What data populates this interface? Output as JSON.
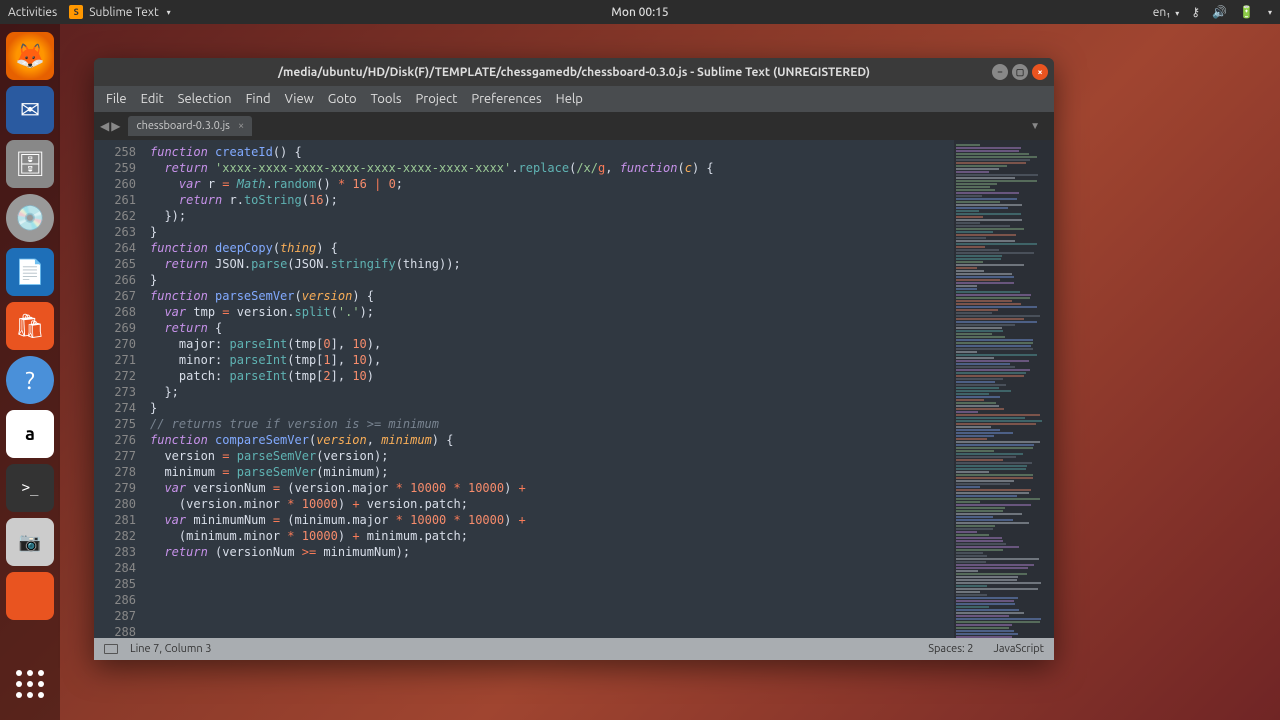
{
  "panel": {
    "activities": "Activities",
    "app_name": "Sublime Text",
    "clock": "Mon 00:15",
    "lang": "en₁"
  },
  "launcher": {
    "items": [
      "firefox",
      "thunderbird",
      "files",
      "disks",
      "writer",
      "software",
      "help",
      "amazon",
      "terminal",
      "screenshot",
      "blank"
    ]
  },
  "window": {
    "title": "/media/ubuntu/HD/Disk(F)/TEMPLATE/chessgamedb/chessboard-0.3.0.js - Sublime Text (UNREGISTERED)",
    "menu": [
      "File",
      "Edit",
      "Selection",
      "Find",
      "View",
      "Goto",
      "Tools",
      "Project",
      "Preferences",
      "Help"
    ],
    "tab": "chessboard-0.3.0.js",
    "status_left": "Line 7, Column 3",
    "status_spaces": "Spaces: 2",
    "status_lang": "JavaScript"
  },
  "code": {
    "first_line": 258,
    "lines": [
      [
        [
          "kw",
          "function"
        ],
        [
          "punct",
          " "
        ],
        [
          "fn",
          "createId"
        ],
        [
          "punct",
          "() {"
        ]
      ],
      [
        [
          "punct",
          "  "
        ],
        [
          "kw",
          "return"
        ],
        [
          "punct",
          " "
        ],
        [
          "str",
          "'xxxx-xxxx-xxxx-xxxx-xxxx-xxxx-xxxx-xxxx'"
        ],
        [
          "punct",
          "."
        ],
        [
          "call",
          "replace"
        ],
        [
          "punct",
          "("
        ],
        [
          "str",
          "/x/"
        ],
        [
          "op",
          "g"
        ],
        [
          "punct",
          ", "
        ],
        [
          "kw",
          "function"
        ],
        [
          "punct",
          "("
        ],
        [
          "param",
          "c"
        ],
        [
          "punct",
          ") {"
        ]
      ],
      [
        [
          "punct",
          "    "
        ],
        [
          "kw",
          "var"
        ],
        [
          "punct",
          " r "
        ],
        [
          "op",
          "="
        ],
        [
          "punct",
          " "
        ],
        [
          "builtin",
          "Math"
        ],
        [
          "punct",
          "."
        ],
        [
          "call",
          "random"
        ],
        [
          "punct",
          "() "
        ],
        [
          "op",
          "*"
        ],
        [
          "punct",
          " "
        ],
        [
          "num",
          "16"
        ],
        [
          "punct",
          " "
        ],
        [
          "op",
          "|"
        ],
        [
          "punct",
          " "
        ],
        [
          "num",
          "0"
        ],
        [
          "punct",
          ";"
        ]
      ],
      [
        [
          "punct",
          "    "
        ],
        [
          "kw",
          "return"
        ],
        [
          "punct",
          " r."
        ],
        [
          "call",
          "toString"
        ],
        [
          "punct",
          "("
        ],
        [
          "num",
          "16"
        ],
        [
          "punct",
          ");"
        ]
      ],
      [
        [
          "punct",
          "  });"
        ]
      ],
      [
        [
          "punct",
          "}"
        ]
      ],
      [
        [
          "punct",
          ""
        ]
      ],
      [
        [
          "kw",
          "function"
        ],
        [
          "punct",
          " "
        ],
        [
          "fn",
          "deepCopy"
        ],
        [
          "punct",
          "("
        ],
        [
          "param",
          "thing"
        ],
        [
          "punct",
          ") {"
        ]
      ],
      [
        [
          "punct",
          "  "
        ],
        [
          "kw",
          "return"
        ],
        [
          "punct",
          " JSON."
        ],
        [
          "call",
          "parse"
        ],
        [
          "punct",
          "(JSON."
        ],
        [
          "call",
          "stringify"
        ],
        [
          "punct",
          "(thing));"
        ]
      ],
      [
        [
          "punct",
          "}"
        ]
      ],
      [
        [
          "punct",
          ""
        ]
      ],
      [
        [
          "kw",
          "function"
        ],
        [
          "punct",
          " "
        ],
        [
          "fn",
          "parseSemVer"
        ],
        [
          "punct",
          "("
        ],
        [
          "param",
          "version"
        ],
        [
          "punct",
          ") {"
        ]
      ],
      [
        [
          "punct",
          "  "
        ],
        [
          "kw",
          "var"
        ],
        [
          "punct",
          " tmp "
        ],
        [
          "op",
          "="
        ],
        [
          "punct",
          " version."
        ],
        [
          "call",
          "split"
        ],
        [
          "punct",
          "("
        ],
        [
          "str",
          "'.'"
        ],
        [
          "punct",
          ");"
        ]
      ],
      [
        [
          "punct",
          "  "
        ],
        [
          "kw",
          "return"
        ],
        [
          "punct",
          " {"
        ]
      ],
      [
        [
          "punct",
          "    major: "
        ],
        [
          "call",
          "parseInt"
        ],
        [
          "punct",
          "(tmp["
        ],
        [
          "num",
          "0"
        ],
        [
          "punct",
          "], "
        ],
        [
          "num",
          "10"
        ],
        [
          "punct",
          "),"
        ]
      ],
      [
        [
          "punct",
          "    minor: "
        ],
        [
          "call",
          "parseInt"
        ],
        [
          "punct",
          "(tmp["
        ],
        [
          "num",
          "1"
        ],
        [
          "punct",
          "], "
        ],
        [
          "num",
          "10"
        ],
        [
          "punct",
          "),"
        ]
      ],
      [
        [
          "punct",
          "    patch: "
        ],
        [
          "call",
          "parseInt"
        ],
        [
          "punct",
          "(tmp["
        ],
        [
          "num",
          "2"
        ],
        [
          "punct",
          "], "
        ],
        [
          "num",
          "10"
        ],
        [
          "punct",
          ")"
        ]
      ],
      [
        [
          "punct",
          "  };"
        ]
      ],
      [
        [
          "punct",
          "}"
        ]
      ],
      [
        [
          "punct",
          ""
        ]
      ],
      [
        [
          "comment",
          "// returns true if version is >= minimum"
        ]
      ],
      [
        [
          "kw",
          "function"
        ],
        [
          "punct",
          " "
        ],
        [
          "fn",
          "compareSemVer"
        ],
        [
          "punct",
          "("
        ],
        [
          "param",
          "version"
        ],
        [
          "punct",
          ", "
        ],
        [
          "param",
          "minimum"
        ],
        [
          "punct",
          ") {"
        ]
      ],
      [
        [
          "punct",
          "  version "
        ],
        [
          "op",
          "="
        ],
        [
          "punct",
          " "
        ],
        [
          "call",
          "parseSemVer"
        ],
        [
          "punct",
          "(version);"
        ]
      ],
      [
        [
          "punct",
          "  minimum "
        ],
        [
          "op",
          "="
        ],
        [
          "punct",
          " "
        ],
        [
          "call",
          "parseSemVer"
        ],
        [
          "punct",
          "(minimum);"
        ]
      ],
      [
        [
          "punct",
          ""
        ]
      ],
      [
        [
          "punct",
          "  "
        ],
        [
          "kw",
          "var"
        ],
        [
          "punct",
          " versionNum "
        ],
        [
          "op",
          "="
        ],
        [
          "punct",
          " (version.major "
        ],
        [
          "op",
          "*"
        ],
        [
          "punct",
          " "
        ],
        [
          "num",
          "10000"
        ],
        [
          "punct",
          " "
        ],
        [
          "op",
          "*"
        ],
        [
          "punct",
          " "
        ],
        [
          "num",
          "10000"
        ],
        [
          "punct",
          ") "
        ],
        [
          "op",
          "+"
        ]
      ],
      [
        [
          "punct",
          "    (version.minor "
        ],
        [
          "op",
          "*"
        ],
        [
          "punct",
          " "
        ],
        [
          "num",
          "10000"
        ],
        [
          "punct",
          ") "
        ],
        [
          "op",
          "+"
        ],
        [
          "punct",
          " version.patch;"
        ]
      ],
      [
        [
          "punct",
          "  "
        ],
        [
          "kw",
          "var"
        ],
        [
          "punct",
          " minimumNum "
        ],
        [
          "op",
          "="
        ],
        [
          "punct",
          " (minimum.major "
        ],
        [
          "op",
          "*"
        ],
        [
          "punct",
          " "
        ],
        [
          "num",
          "10000"
        ],
        [
          "punct",
          " "
        ],
        [
          "op",
          "*"
        ],
        [
          "punct",
          " "
        ],
        [
          "num",
          "10000"
        ],
        [
          "punct",
          ") "
        ],
        [
          "op",
          "+"
        ]
      ],
      [
        [
          "punct",
          "    (minimum.minor "
        ],
        [
          "op",
          "*"
        ],
        [
          "punct",
          " "
        ],
        [
          "num",
          "10000"
        ],
        [
          "punct",
          ") "
        ],
        [
          "op",
          "+"
        ],
        [
          "punct",
          " minimum.patch;"
        ]
      ],
      [
        [
          "punct",
          ""
        ]
      ],
      [
        [
          "punct",
          "  "
        ],
        [
          "kw",
          "return"
        ],
        [
          "punct",
          " (versionNum "
        ],
        [
          "op",
          ">="
        ],
        [
          "punct",
          " minimumNum);"
        ]
      ]
    ]
  }
}
